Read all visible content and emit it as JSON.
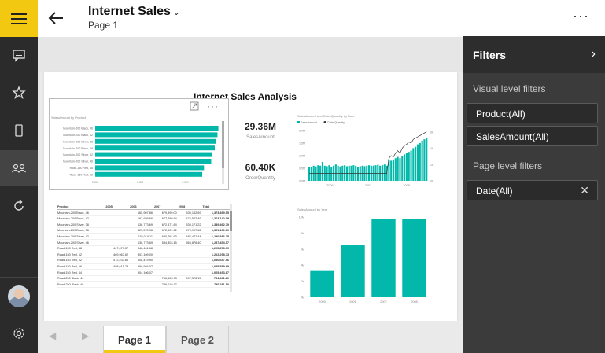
{
  "header": {
    "title": "Internet Sales",
    "subtitle": "Page 1"
  },
  "report": {
    "title": "Internet Sales Analysis",
    "bar_chart": {
      "title": "SalesAmount by Product",
      "categories": [
        "Mountain-200 Black, 46",
        "Mountain-200 Black, 42",
        "Mountain-200 Silver, 38",
        "Mountain-200 Black, 38",
        "Mountain-200 Silver, 42",
        "Mountain-200 Silver, 46",
        "Road-150 Red, 48",
        "Road-150 Red, 62"
      ],
      "values": [
        1.37,
        1.36,
        1.34,
        1.33,
        1.3,
        1.29,
        1.21,
        1.19
      ],
      "ticks": [
        "0.0M",
        "0.5M",
        "1.0M"
      ],
      "xlim": [
        0,
        1.4
      ]
    },
    "card_sales": {
      "value": "29.36M",
      "label": "SalesAmount"
    },
    "card_qty": {
      "value": "60.40K",
      "label": "OrderQuantity"
    },
    "combo_chart": {
      "title": "SalesAmount and OrderQuantity by Date",
      "legend": [
        "SalesAmount",
        "OrderQuantity"
      ],
      "y_ticks": [
        "2.0M",
        "1.5M",
        "1.0M",
        "0.5M",
        "0.0M"
      ],
      "y2_ticks": [
        "6K",
        "4K",
        "2K",
        "0K"
      ],
      "x_ticks": [
        "2006",
        "2007",
        "2008"
      ],
      "bars": [
        0.55,
        0.55,
        0.6,
        0.57,
        0.62,
        0.6,
        0.75,
        0.6,
        0.58,
        0.62,
        0.56,
        0.6,
        0.65,
        0.6,
        0.57,
        0.6,
        0.62,
        0.58,
        0.6,
        0.6,
        0.62,
        0.6,
        0.55,
        0.58,
        0.6,
        0.58,
        0.6,
        0.62,
        0.6,
        0.6,
        0.62,
        0.64,
        0.6,
        0.62,
        0.65,
        0.6,
        0.85,
        0.8,
        0.85,
        0.9,
        0.95,
        0.9,
        1.0,
        1.05,
        1.1,
        1.15,
        1.2,
        1.3,
        1.35,
        1.45,
        1.5,
        1.6,
        1.65,
        1.7
      ],
      "line": [
        0.3,
        0.3,
        0.3,
        0.3,
        0.3,
        0.3,
        0.3,
        0.3,
        0.3,
        0.3,
        0.3,
        0.3,
        0.3,
        0.3,
        0.3,
        0.3,
        0.3,
        0.3,
        0.3,
        0.3,
        0.3,
        0.3,
        0.3,
        0.3,
        0.3,
        0.3,
        0.3,
        0.3,
        0.3,
        0.3,
        0.3,
        0.3,
        0.3,
        0.3,
        0.3,
        0.3,
        0.9,
        1.0,
        0.95,
        1.1,
        1.2,
        1.1,
        1.3,
        1.4,
        1.45,
        1.55,
        1.5,
        1.65,
        1.7,
        1.75,
        1.8,
        1.85,
        1.9,
        1.95
      ]
    },
    "year_chart": {
      "title": "SalesAmount by Year",
      "categories": [
        "2005",
        "2006",
        "2007",
        "2008"
      ],
      "values": [
        3.27,
        6.53,
        9.79,
        9.77
      ],
      "y_ticks": [
        "10M",
        "8M",
        "6M",
        "4M",
        "2M",
        "0M"
      ],
      "ylim": [
        0,
        10
      ]
    },
    "table": {
      "headers": [
        "Product",
        "2005",
        "2006",
        "2007",
        "2008",
        "Total"
      ],
      "rows": [
        [
          "Mountain-200 Black, 46",
          "",
          "165,907.86",
          "679,999.00",
          "530,142.69",
          "1,373,469.55"
        ],
        [
          "Mountain-200 Black, 42",
          "",
          "193,929.66",
          "677,799.94",
          "476,542.49",
          "1,363,142.09"
        ],
        [
          "Mountain-200 Silver, 38",
          "",
          "136,773.69",
          "672,471.64",
          "530,171.22",
          "1,339,462.79"
        ],
        [
          "Mountain-200 Black, 38",
          "",
          "323,570.98",
          "672,601.62",
          "479,997.62",
          "1,351,100.19"
        ],
        [
          "Mountain-200 Silver, 42",
          "",
          "138,010.11",
          "630,791.63",
          "487,477.44",
          "1,290,886.35"
        ],
        [
          "Mountain-200 Silver, 46",
          "",
          "136,773.69",
          "584,803.15",
          "566,876.40",
          "1,287,454.57"
        ],
        [
          "Road-150 Red, 48",
          "447,479.37",
          "848,401.68",
          "",
          "",
          "1,205,876.99"
        ],
        [
          "Road-150 Red, 62",
          "469,967.62",
          "803,109.00",
          "",
          "",
          "1,202,298.73"
        ],
        [
          "Road-150 Red, 52",
          "472,237.66",
          "608,419.90",
          "",
          "",
          "1,080,657.56"
        ],
        [
          "Road-150 Red, 56",
          "498,615.73",
          "598,984.07",
          "",
          "",
          "1,055,589.69"
        ],
        [
          "Road-150 Red, 44",
          "",
          "904,106.07",
          "",
          "",
          "1,005,493.87"
        ],
        [
          "Road-250 Black, 44",
          "",
          "",
          "756,603.73",
          "597,378.15",
          "754,401.80"
        ],
        [
          "Road-250 Black, 48",
          "",
          "",
          "736,019.77",
          "",
          "750,281.50"
        ]
      ]
    }
  },
  "pages": {
    "tab1": "Page 1",
    "tab2": "Page 2"
  },
  "filters": {
    "title": "Filters",
    "visual_label": "Visual level filters",
    "visual_items": [
      "Product(All)",
      "SalesAmount(All)"
    ],
    "page_label": "Page level filters",
    "page_items": [
      "Date(All)"
    ]
  },
  "colors": {
    "accent": "#f2c811",
    "teal": "#01b8aa",
    "rail": "#2b2b2b",
    "filters_bg": "#3b3b3b"
  },
  "icons": [
    "hamburger-icon",
    "report-icon",
    "star-icon",
    "mobile-icon",
    "workspaces-icon",
    "refresh-icon",
    "settings-icon",
    "back-arrow-icon",
    "expand-icon",
    "search-icon",
    "more-icon",
    "chevron-right-icon",
    "close-icon"
  ]
}
